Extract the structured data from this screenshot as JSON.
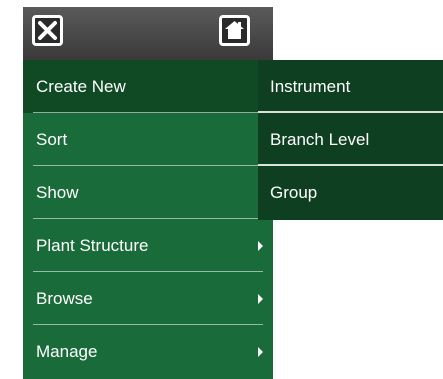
{
  "topbar": {
    "close_icon": "close-icon",
    "home_icon": "home-icon"
  },
  "menu": {
    "items": [
      {
        "label": "Create New",
        "has_submenu": false,
        "selected": true
      },
      {
        "label": "Sort",
        "has_submenu": false
      },
      {
        "label": "Show",
        "has_submenu": false
      },
      {
        "label": "Plant Structure",
        "has_submenu": true
      },
      {
        "label": "Browse",
        "has_submenu": true
      },
      {
        "label": "Manage",
        "has_submenu": true
      }
    ]
  },
  "submenu": {
    "items": [
      {
        "label": "Instrument"
      },
      {
        "label": "Branch Level"
      },
      {
        "label": "Group"
      }
    ]
  },
  "colors": {
    "menu_bg": "#1a6b3a",
    "selected_bg": "#0f4a25",
    "submenu_bg": "#0f3f21",
    "topbar_bg": "#4a4a4a"
  }
}
